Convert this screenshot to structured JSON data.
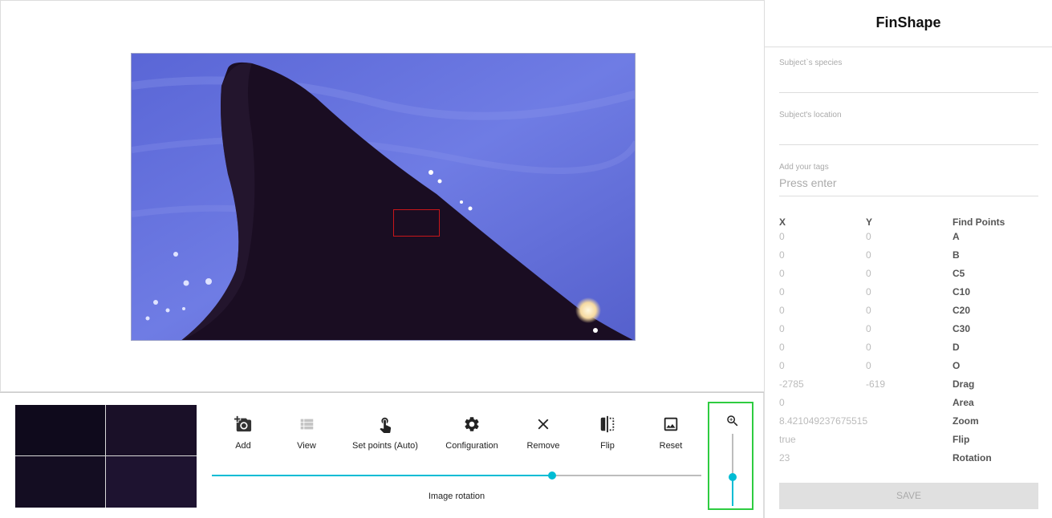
{
  "app": {
    "title": "FinShape"
  },
  "toolbar": {
    "tools": [
      {
        "label": "Add",
        "icon": "add-photo-icon",
        "enabled": true
      },
      {
        "label": "View",
        "icon": "list-icon",
        "enabled": false
      },
      {
        "label": "Set points (Auto)",
        "icon": "touch-icon",
        "enabled": true
      },
      {
        "label": "Configuration",
        "icon": "gear-icon",
        "enabled": true
      },
      {
        "label": "Remove",
        "icon": "close-icon",
        "enabled": true
      },
      {
        "label": "Flip",
        "icon": "flip-icon",
        "enabled": true
      },
      {
        "label": "Reset",
        "icon": "image-icon",
        "enabled": true
      }
    ]
  },
  "rotation": {
    "label": "Image rotation",
    "value_fraction": 0.695
  },
  "zoom": {
    "icon": "zoom-in-icon",
    "value_fraction": 0.4
  },
  "form": {
    "species_label": "Subject`s species",
    "location_label": "Subject's location",
    "tags_label": "Add your tags",
    "tags_placeholder": "Press enter"
  },
  "coords": {
    "headers": {
      "x": "X",
      "y": "Y",
      "name": "Find Points"
    },
    "rows": [
      {
        "x": "0",
        "y": "0",
        "name": "A"
      },
      {
        "x": "0",
        "y": "0",
        "name": "B"
      },
      {
        "x": "0",
        "y": "0",
        "name": "C5"
      },
      {
        "x": "0",
        "y": "0",
        "name": "C10"
      },
      {
        "x": "0",
        "y": "0",
        "name": "C20"
      },
      {
        "x": "0",
        "y": "0",
        "name": "C30"
      },
      {
        "x": "0",
        "y": "0",
        "name": "D"
      },
      {
        "x": "0",
        "y": "0",
        "name": "O"
      },
      {
        "x": "-2785",
        "y": "-619",
        "name": "Drag"
      },
      {
        "x": "0",
        "y": "",
        "name": "Area"
      },
      {
        "x": "8.421049237675515",
        "y": "",
        "name": "Zoom"
      },
      {
        "x": "true",
        "y": "",
        "name": "Flip"
      },
      {
        "x": "23",
        "y": "",
        "name": "Rotation"
      }
    ]
  },
  "save_label": "SAVE",
  "colors": {
    "accent": "#00bcd4",
    "zoom_border": "#2ecc40",
    "selection": "#c8161a"
  }
}
